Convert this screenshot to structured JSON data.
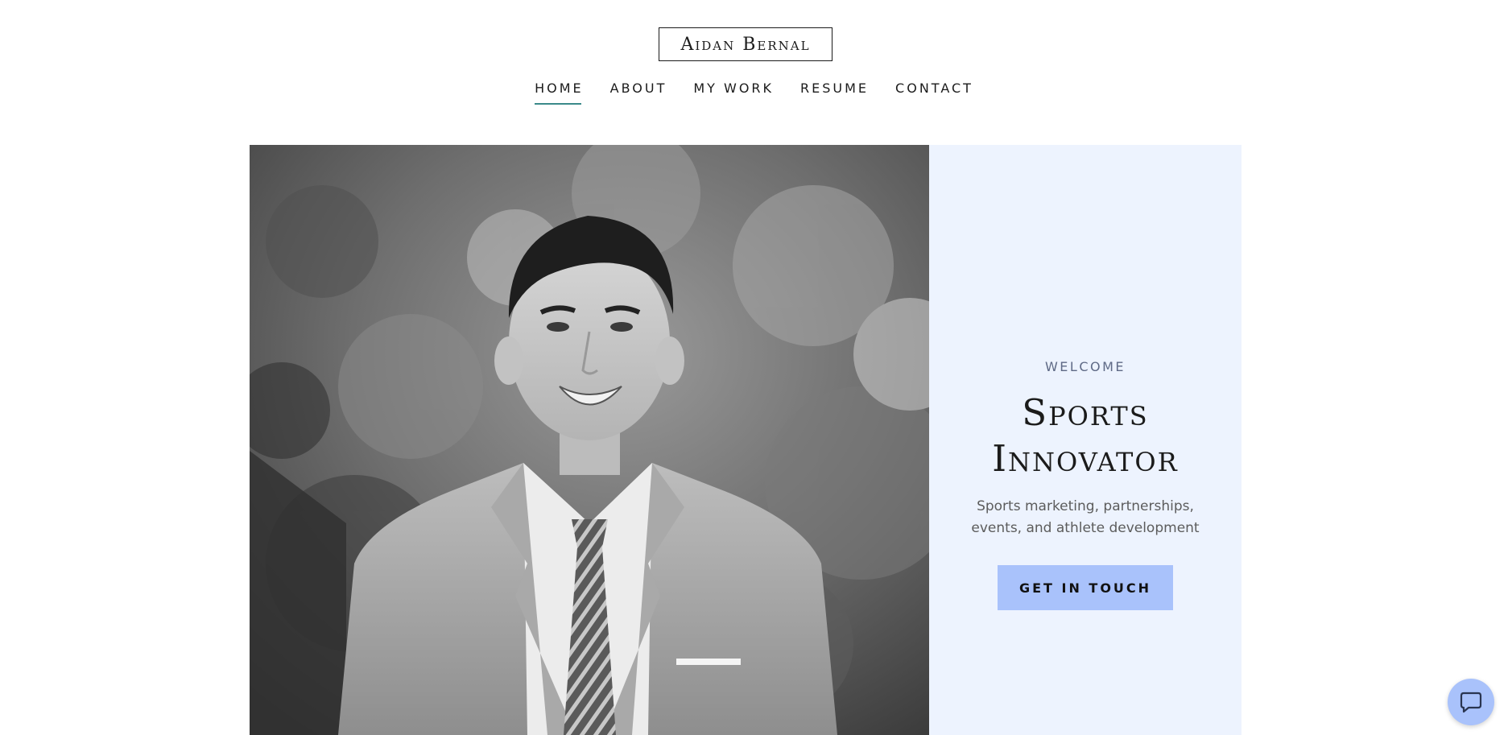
{
  "site": {
    "logo": "Aidan Bernal"
  },
  "nav": {
    "items": [
      {
        "label": "HOME",
        "active": true
      },
      {
        "label": "ABOUT",
        "active": false
      },
      {
        "label": "MY WORK",
        "active": false
      },
      {
        "label": "RESUME",
        "active": false
      },
      {
        "label": "CONTACT",
        "active": false
      }
    ]
  },
  "hero": {
    "eyebrow": "WELCOME",
    "headline_line1": "Sports",
    "headline_line2": "Innovator",
    "subtext": "Sports marketing, partnerships, events, and athlete development",
    "cta_label": "GET IN TOUCH"
  },
  "chat": {
    "icon": "chat-bubble-icon"
  },
  "colors": {
    "accent": "#a9c2fb",
    "panel_bg": "#edf3fe",
    "nav_underline": "#3b8a8a",
    "text": "#1b1b1b",
    "eyebrow": "#5f6a86"
  }
}
